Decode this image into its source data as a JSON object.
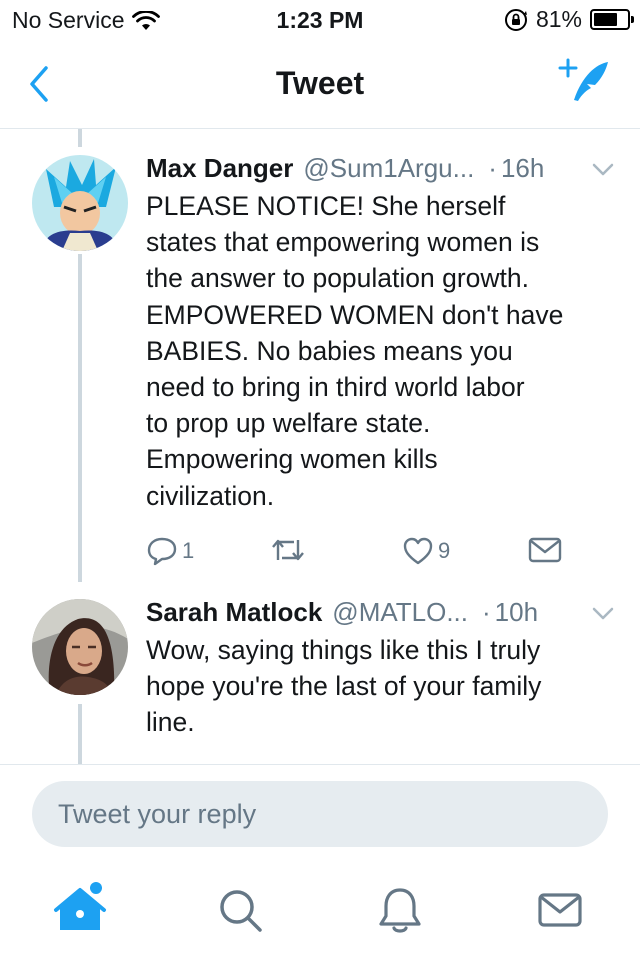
{
  "status_bar": {
    "carrier": "No Service",
    "time": "1:23 PM",
    "battery_percent": "81%",
    "battery_level": 0.81,
    "icons": [
      "wifi-icon",
      "orientation-lock-icon",
      "battery-icon"
    ]
  },
  "nav": {
    "title": "Tweet",
    "back_icon": "chevron-left-icon",
    "compose_icon": "compose-tweet-icon"
  },
  "tweets": [
    {
      "name": "Max Danger",
      "handle": "@Sum1Argu...",
      "dot": "·",
      "time": "16h",
      "lines": [
        "PLEASE NOTICE! She herself",
        "states that empowering women is",
        "the answer to population growth.",
        "EMPOWERED WOMEN don't have",
        "BABIES. No babies means you",
        "need to bring in third world labor",
        "to prop up welfare state.",
        "Empowering women kills",
        "civilization."
      ],
      "actions": {
        "reply_count": "1",
        "retweet_count": "",
        "like_count": "9"
      }
    },
    {
      "name": "Sarah Matlock",
      "handle": "@MATLO...",
      "dot": "·",
      "time": "10h",
      "lines": [
        "Wow, saying things like this I truly",
        "hope you're the last of your family",
        "line."
      ]
    }
  ],
  "reply": {
    "placeholder": "Tweet your reply",
    "value": ""
  },
  "tab_bar": {
    "items": [
      "home-icon",
      "search-icon",
      "notifications-icon",
      "messages-icon"
    ],
    "accent_color": "#1da1f2",
    "inactive_color": "#657786"
  }
}
